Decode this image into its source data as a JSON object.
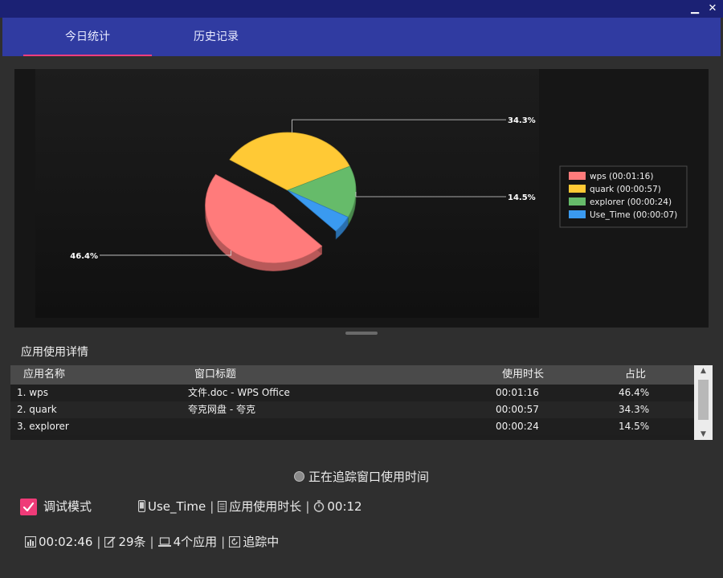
{
  "window": {
    "minimize_label": "▁",
    "close_label": "✕"
  },
  "tabs": [
    {
      "label": "今日统计",
      "active": true
    },
    {
      "label": "历史记录",
      "active": false
    }
  ],
  "chart_data": {
    "type": "pie",
    "title": "",
    "exploded": "wps",
    "slices": [
      {
        "name": "wps",
        "label": "wps (00:01:16)",
        "value": 46.4,
        "percent": "46.4%",
        "color": "#ff7b7b"
      },
      {
        "name": "quark",
        "label": "quark (00:00:57)",
        "value": 34.3,
        "percent": "34.3%",
        "color": "#ffc935"
      },
      {
        "name": "explorer",
        "label": "explorer (00:00:24)",
        "value": 14.5,
        "percent": "14.5%",
        "color": "#66bb6a"
      },
      {
        "name": "Use_Time",
        "label": "Use_Time (00:00:07)",
        "value": 4.8,
        "percent": "",
        "color": "#3a9af0"
      }
    ],
    "legend_position": "right"
  },
  "details": {
    "title": "应用使用详情",
    "columns": [
      "应用名称",
      "窗口标题",
      "使用时长",
      "占比"
    ],
    "rows": [
      {
        "app": "1. wps",
        "window": "文件.doc - WPS Office",
        "duration": "00:01:16",
        "share": "46.4%"
      },
      {
        "app": "2. quark",
        "window": "夸克网盘 - 夸克",
        "duration": "00:00:57",
        "share": "34.3%"
      },
      {
        "app": "3. explorer",
        "window": "",
        "duration": "00:00:24",
        "share": "14.5%"
      }
    ]
  },
  "status": {
    "tracking_text": "正在追踪窗口使用时间"
  },
  "debug": {
    "label": "调试模式",
    "checked": true
  },
  "info_line1": {
    "current_app": "Use_Time",
    "current_window": "应用使用时长",
    "session_time": "00:12"
  },
  "info_line2": {
    "total_time": "00:02:46",
    "record_count": "29条",
    "app_count": "4个应用",
    "state": "追踪中"
  }
}
